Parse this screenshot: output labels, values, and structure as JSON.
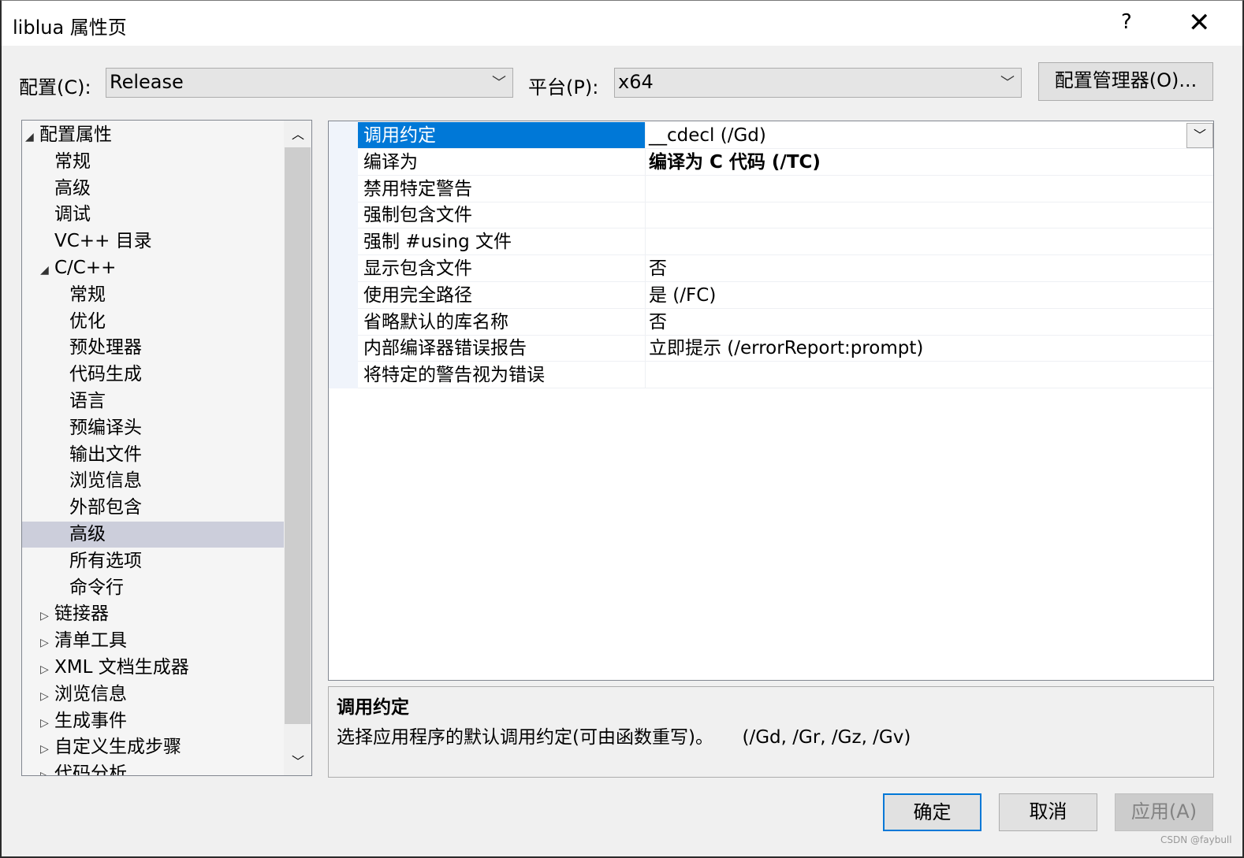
{
  "window": {
    "title": "liblua 属性页",
    "help": "?",
    "close": "✕"
  },
  "config": {
    "label": "配置(C):",
    "value": "Release",
    "platform_label": "平台(P):",
    "platform_value": "x64",
    "manager_button": "配置管理器(O)..."
  },
  "tree": [
    {
      "label": "配置属性",
      "level": 0,
      "expander": "expanded"
    },
    {
      "label": "常规",
      "level": 1
    },
    {
      "label": "高级",
      "level": 1
    },
    {
      "label": "调试",
      "level": 1
    },
    {
      "label": "VC++ 目录",
      "level": 1
    },
    {
      "label": "C/C++",
      "level": 1,
      "expander": "expanded"
    },
    {
      "label": "常规",
      "level": 2
    },
    {
      "label": "优化",
      "level": 2
    },
    {
      "label": "预处理器",
      "level": 2
    },
    {
      "label": "代码生成",
      "level": 2
    },
    {
      "label": "语言",
      "level": 2
    },
    {
      "label": "预编译头",
      "level": 2
    },
    {
      "label": "输出文件",
      "level": 2
    },
    {
      "label": "浏览信息",
      "level": 2
    },
    {
      "label": "外部包含",
      "level": 2
    },
    {
      "label": "高级",
      "level": 2,
      "selected": true
    },
    {
      "label": "所有选项",
      "level": 2
    },
    {
      "label": "命令行",
      "level": 2
    },
    {
      "label": "链接器",
      "level": 1,
      "expander": "collapsed"
    },
    {
      "label": "清单工具",
      "level": 1,
      "expander": "collapsed"
    },
    {
      "label": "XML 文档生成器",
      "level": 1,
      "expander": "collapsed"
    },
    {
      "label": "浏览信息",
      "level": 1,
      "expander": "collapsed"
    },
    {
      "label": "生成事件",
      "level": 1,
      "expander": "collapsed"
    },
    {
      "label": "自定义生成步骤",
      "level": 1,
      "expander": "collapsed"
    },
    {
      "label": "代码分析",
      "level": 1,
      "expander": "collapsed"
    }
  ],
  "properties": [
    {
      "name": "调用约定",
      "value": "__cdecl (/Gd)",
      "selected": true
    },
    {
      "name": "编译为",
      "value": "编译为 C 代码 (/TC)",
      "bold": true
    },
    {
      "name": "禁用特定警告",
      "value": ""
    },
    {
      "name": "强制包含文件",
      "value": ""
    },
    {
      "name": "强制 #using 文件",
      "value": ""
    },
    {
      "name": "显示包含文件",
      "value": "否"
    },
    {
      "name": "使用完全路径",
      "value": "是 (/FC)"
    },
    {
      "name": "省略默认的库名称",
      "value": "否"
    },
    {
      "name": "内部编译器错误报告",
      "value": "立即提示 (/errorReport:prompt)"
    },
    {
      "name": "将特定的警告视为错误",
      "value": ""
    }
  ],
  "description": {
    "title": "调用约定",
    "text": "选择应用程序的默认调用约定(可由函数重写)。     (/Gd, /Gr, /Gz, /Gv)"
  },
  "buttons": {
    "ok": "确定",
    "cancel": "取消",
    "apply": "应用(A)"
  },
  "watermark": "CSDN @faybull",
  "colors": {
    "selection": "#0078d7",
    "tree_selection": "#cccedb"
  }
}
